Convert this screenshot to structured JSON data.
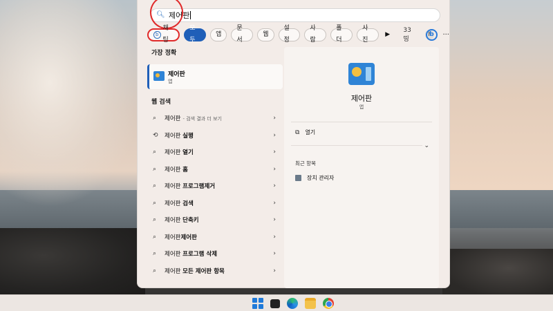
{
  "search": {
    "query": "제어판"
  },
  "filters": {
    "chat_label": "채팅",
    "chips": [
      "모두",
      "앱",
      "문서",
      "웹",
      "설정",
      "사람",
      "폴더",
      "사진"
    ],
    "count": "33",
    "count_glyph": "띵",
    "avatar_letter": "F"
  },
  "best_match": {
    "title": "가장 정확",
    "name": "제어판",
    "type": "앱"
  },
  "web_search": {
    "title": "웹 검색",
    "items": [
      {
        "prefix": "제어판",
        "bold": "",
        "hint": "- 검색 결과 더 보기",
        "icon": "search-icon"
      },
      {
        "prefix": "제어판 ",
        "bold": "실행",
        "hint": "",
        "icon": "history-icon"
      },
      {
        "prefix": "제어판 ",
        "bold": "열기",
        "hint": "",
        "icon": "search-icon"
      },
      {
        "prefix": "제어판 ",
        "bold": "홈",
        "hint": "",
        "icon": "search-icon"
      },
      {
        "prefix": "제어판 ",
        "bold": "프로그램제거",
        "hint": "",
        "icon": "search-icon"
      },
      {
        "prefix": "제어판 ",
        "bold": "검색",
        "hint": "",
        "icon": "search-icon"
      },
      {
        "prefix": "제어판 ",
        "bold": "단축키",
        "hint": "",
        "icon": "search-icon"
      },
      {
        "prefix": "제어판",
        "bold": "제어판",
        "hint": "",
        "icon": "search-icon"
      },
      {
        "prefix": "제어판 ",
        "bold": "프로그램 삭제",
        "hint": "",
        "icon": "search-icon"
      },
      {
        "prefix": "제어판 ",
        "bold": "모든 제어판 항목",
        "hint": "",
        "icon": "search-icon"
      }
    ]
  },
  "details": {
    "name": "제어판",
    "type": "앱",
    "open_label": "열기",
    "recent_title": "최근 항목",
    "recent_items": [
      "장치 관리자"
    ]
  }
}
